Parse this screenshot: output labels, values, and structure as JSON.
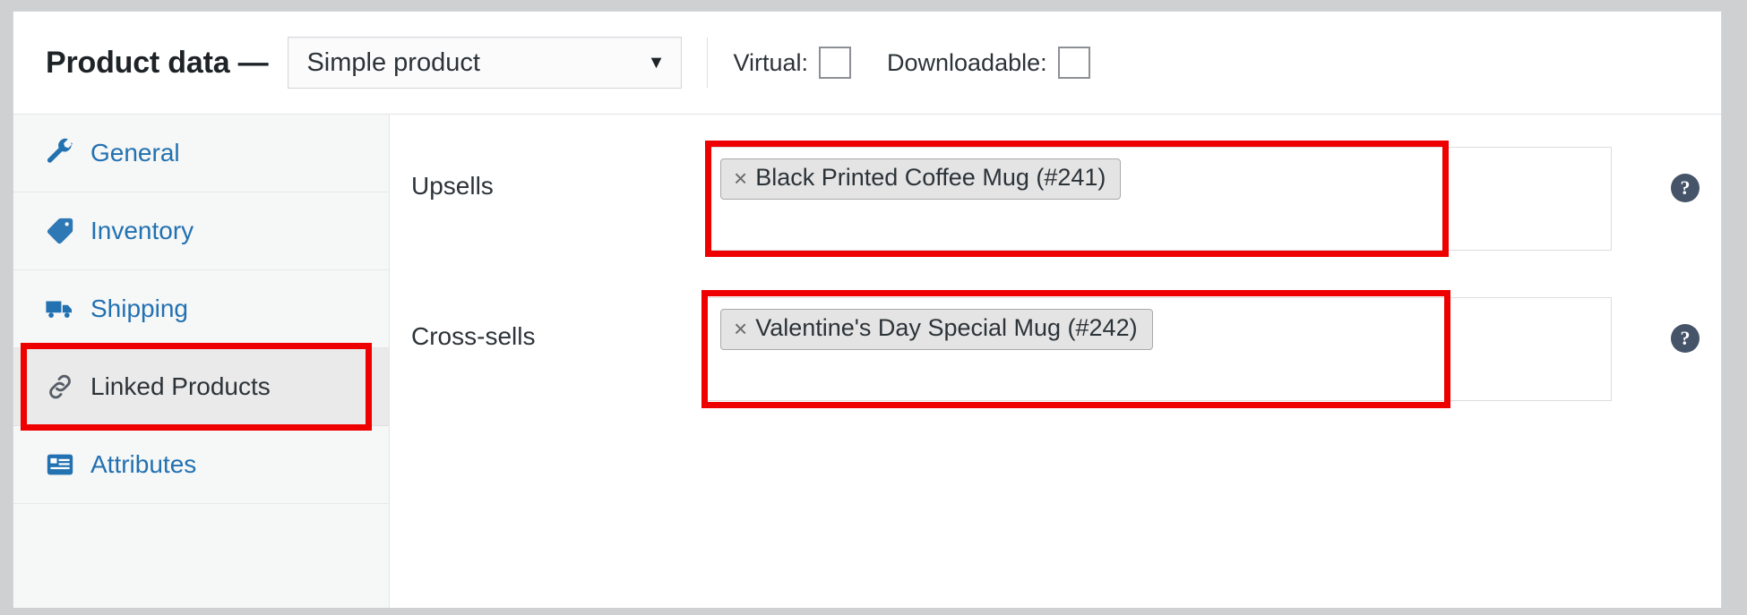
{
  "header": {
    "title": "Product data —",
    "product_type": {
      "selected": "Simple product",
      "caret": "▼"
    },
    "checkboxes": [
      {
        "label": "Virtual:",
        "checked": false
      },
      {
        "label": "Downloadable:",
        "checked": false
      }
    ]
  },
  "tabs": [
    {
      "label": "General",
      "icon": "wrench-icon",
      "active": false
    },
    {
      "label": "Inventory",
      "icon": "tag-icon",
      "active": false
    },
    {
      "label": "Shipping",
      "icon": "truck-icon",
      "active": false
    },
    {
      "label": "Linked Products",
      "icon": "link-icon",
      "active": true
    },
    {
      "label": "Attributes",
      "icon": "list-icon",
      "active": false
    }
  ],
  "fields": [
    {
      "label": "Upsells",
      "tokens": [
        {
          "remove": "×",
          "text": "Black Printed Coffee Mug (#241)"
        }
      ],
      "help": "?"
    },
    {
      "label": "Cross-sells",
      "tokens": [
        {
          "remove": "×",
          "text": "Valentine's Day Special Mug (#242)"
        }
      ],
      "help": "?"
    }
  ],
  "colors": {
    "link_blue": "#2271b1",
    "annotation_red": "#ee0000",
    "active_tab_bg": "#eaeaea",
    "panel_bg": "#ffffff",
    "sidebar_bg": "#f6f7f7",
    "page_bg": "#cfd0d1",
    "help_icon_bg": "#46546a"
  }
}
